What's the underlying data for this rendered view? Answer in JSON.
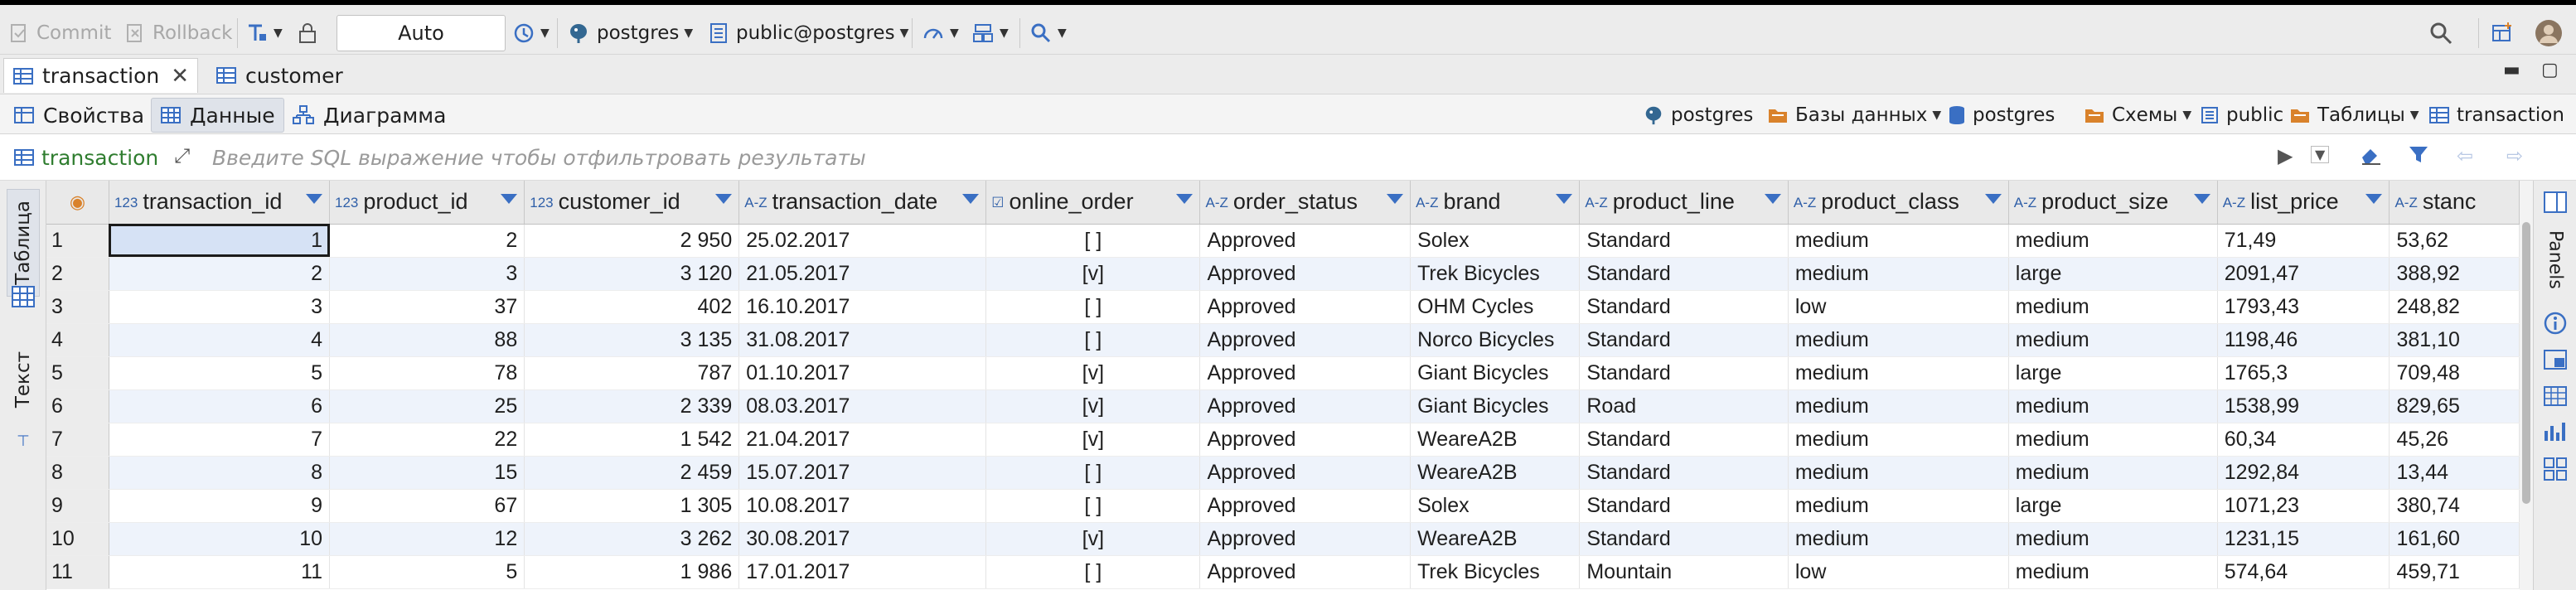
{
  "toolbar": {
    "commit": "Commit",
    "rollback": "Rollback",
    "transaction_mode": "Auto",
    "datasource": "postgres",
    "schema": "public@postgres"
  },
  "editor_tabs": [
    {
      "label": "transaction"
    },
    {
      "label": "customer"
    }
  ],
  "sub_tabs": [
    {
      "label": "Свойства"
    },
    {
      "label": "Данные"
    },
    {
      "label": "Диаграмма"
    }
  ],
  "breadcrumb": {
    "connection": "postgres",
    "databases": "Базы данных",
    "database": "postgres",
    "schemas": "Схемы",
    "schema": "public",
    "tables": "Таблицы",
    "table": "transaction"
  },
  "filter": {
    "table_name": "transaction",
    "placeholder": "Введите SQL выражение чтобы отфильтровать результаты"
  },
  "side_panels": {
    "table_tab": "Таблица",
    "text_tab": "Текст",
    "panels_tab": "Panels"
  },
  "columns": [
    {
      "name": "transaction_id",
      "type_tag": "123"
    },
    {
      "name": "product_id",
      "type_tag": "123"
    },
    {
      "name": "customer_id",
      "type_tag": "123"
    },
    {
      "name": "transaction_date",
      "type_tag": "A-Z"
    },
    {
      "name": "online_order",
      "type_tag": "☑"
    },
    {
      "name": "order_status",
      "type_tag": "A-Z"
    },
    {
      "name": "brand",
      "type_tag": "A-Z"
    },
    {
      "name": "product_line",
      "type_tag": "A-Z"
    },
    {
      "name": "product_class",
      "type_tag": "A-Z"
    },
    {
      "name": "product_size",
      "type_tag": "A-Z"
    },
    {
      "name": "list_price",
      "type_tag": "A-Z"
    },
    {
      "name": "stanc",
      "type_tag": "A-Z"
    }
  ],
  "rows": [
    {
      "n": "1",
      "transaction_id": "1",
      "product_id": "2",
      "customer_id": "2 950",
      "transaction_date": "25.02.2017",
      "online_order": "[ ]",
      "order_status": "Approved",
      "brand": "Solex",
      "product_line": "Standard",
      "product_class": "medium",
      "product_size": "medium",
      "list_price": "71,49",
      "standard_cost": "53,62"
    },
    {
      "n": "2",
      "transaction_id": "2",
      "product_id": "3",
      "customer_id": "3 120",
      "transaction_date": "21.05.2017",
      "online_order": "[v]",
      "order_status": "Approved",
      "brand": "Trek Bicycles",
      "product_line": "Standard",
      "product_class": "medium",
      "product_size": "large",
      "list_price": "2091,47",
      "standard_cost": "388,92"
    },
    {
      "n": "3",
      "transaction_id": "3",
      "product_id": "37",
      "customer_id": "402",
      "transaction_date": "16.10.2017",
      "online_order": "[ ]",
      "order_status": "Approved",
      "brand": "OHM Cycles",
      "product_line": "Standard",
      "product_class": "low",
      "product_size": "medium",
      "list_price": "1793,43",
      "standard_cost": "248,82"
    },
    {
      "n": "4",
      "transaction_id": "4",
      "product_id": "88",
      "customer_id": "3 135",
      "transaction_date": "31.08.2017",
      "online_order": "[ ]",
      "order_status": "Approved",
      "brand": "Norco Bicycles",
      "product_line": "Standard",
      "product_class": "medium",
      "product_size": "medium",
      "list_price": "1198,46",
      "standard_cost": "381,10"
    },
    {
      "n": "5",
      "transaction_id": "5",
      "product_id": "78",
      "customer_id": "787",
      "transaction_date": "01.10.2017",
      "online_order": "[v]",
      "order_status": "Approved",
      "brand": "Giant Bicycles",
      "product_line": "Standard",
      "product_class": "medium",
      "product_size": "large",
      "list_price": "1765,3",
      "standard_cost": "709,48"
    },
    {
      "n": "6",
      "transaction_id": "6",
      "product_id": "25",
      "customer_id": "2 339",
      "transaction_date": "08.03.2017",
      "online_order": "[v]",
      "order_status": "Approved",
      "brand": "Giant Bicycles",
      "product_line": "Road",
      "product_class": "medium",
      "product_size": "medium",
      "list_price": "1538,99",
      "standard_cost": "829,65"
    },
    {
      "n": "7",
      "transaction_id": "7",
      "product_id": "22",
      "customer_id": "1 542",
      "transaction_date": "21.04.2017",
      "online_order": "[v]",
      "order_status": "Approved",
      "brand": "WeareA2B",
      "product_line": "Standard",
      "product_class": "medium",
      "product_size": "medium",
      "list_price": "60,34",
      "standard_cost": "45,26"
    },
    {
      "n": "8",
      "transaction_id": "8",
      "product_id": "15",
      "customer_id": "2 459",
      "transaction_date": "15.07.2017",
      "online_order": "[ ]",
      "order_status": "Approved",
      "brand": "WeareA2B",
      "product_line": "Standard",
      "product_class": "medium",
      "product_size": "medium",
      "list_price": "1292,84",
      "standard_cost": "13,44"
    },
    {
      "n": "9",
      "transaction_id": "9",
      "product_id": "67",
      "customer_id": "1 305",
      "transaction_date": "10.08.2017",
      "online_order": "[ ]",
      "order_status": "Approved",
      "brand": "Solex",
      "product_line": "Standard",
      "product_class": "medium",
      "product_size": "large",
      "list_price": "1071,23",
      "standard_cost": "380,74"
    },
    {
      "n": "10",
      "transaction_id": "10",
      "product_id": "12",
      "customer_id": "3 262",
      "transaction_date": "30.08.2017",
      "online_order": "[v]",
      "order_status": "Approved",
      "brand": "WeareA2B",
      "product_line": "Standard",
      "product_class": "medium",
      "product_size": "medium",
      "list_price": "1231,15",
      "standard_cost": "161,60"
    },
    {
      "n": "11",
      "transaction_id": "11",
      "product_id": "5",
      "customer_id": "1 986",
      "transaction_date": "17.01.2017",
      "online_order": "[ ]",
      "order_status": "Approved",
      "brand": "Trek Bicycles",
      "product_line": "Mountain",
      "product_class": "low",
      "product_size": "medium",
      "list_price": "574,64",
      "standard_cost": "459,71"
    }
  ],
  "colors": {
    "accent": "#3a6fc3",
    "filter_green": "#2f7d2f",
    "row_stripe": "#eef3fb",
    "header_bg": "#e9e9e9"
  }
}
